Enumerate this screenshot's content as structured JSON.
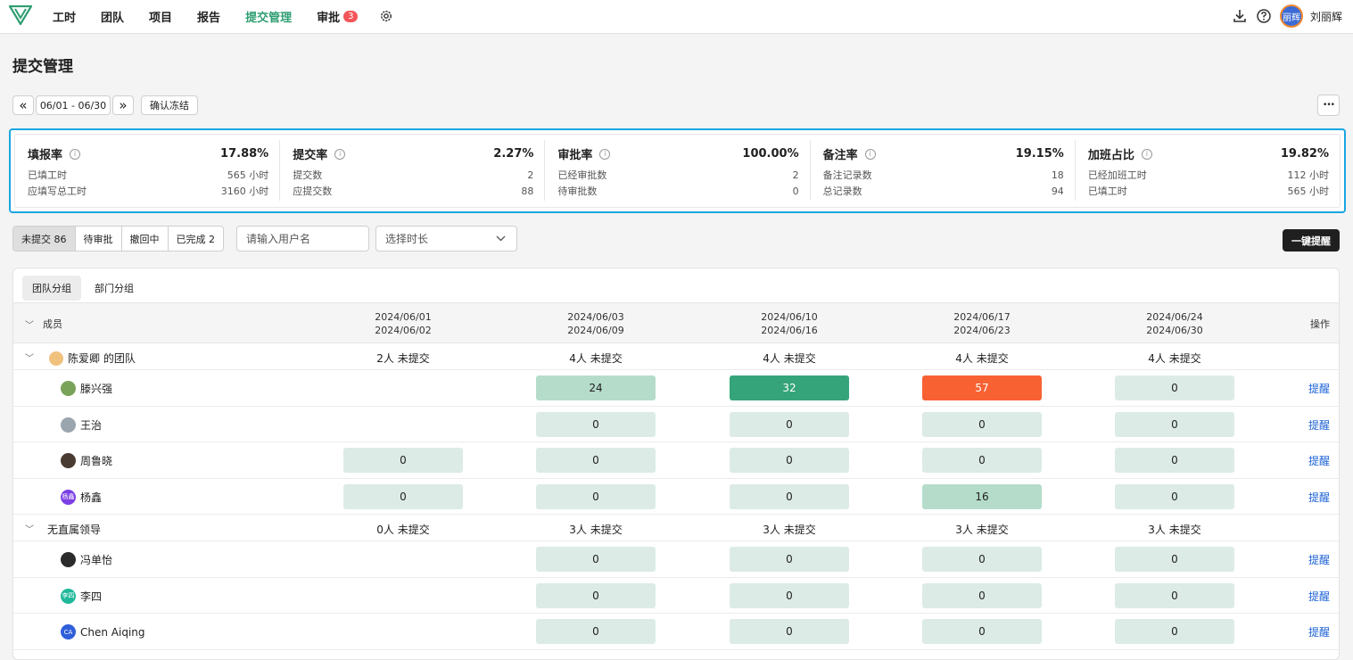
{
  "nav": {
    "items": [
      {
        "label": "工时"
      },
      {
        "label": "团队"
      },
      {
        "label": "项目"
      },
      {
        "label": "报告"
      },
      {
        "label": "提交管理",
        "active": true
      },
      {
        "label": "审批",
        "badge": "3"
      }
    ],
    "user": {
      "avatar_text": "丽辉",
      "name": "刘丽辉"
    }
  },
  "page": {
    "title": "提交管理"
  },
  "toolbar": {
    "date_range": "06/01 - 06/30",
    "freeze_label": "确认冻结",
    "more_label": "•••"
  },
  "stats": [
    {
      "title": "填报率",
      "value": "17.88%",
      "rows": [
        {
          "label": "已填工时",
          "value": "565 小时"
        },
        {
          "label": "应填写总工时",
          "value": "3160 小时"
        }
      ]
    },
    {
      "title": "提交率",
      "value": "2.27%",
      "rows": [
        {
          "label": "提交数",
          "value": "2"
        },
        {
          "label": "应提交数",
          "value": "88"
        }
      ]
    },
    {
      "title": "审批率",
      "value": "100.00%",
      "rows": [
        {
          "label": "已经审批数",
          "value": "2"
        },
        {
          "label": "待审批数",
          "value": "0"
        }
      ]
    },
    {
      "title": "备注率",
      "value": "19.15%",
      "rows": [
        {
          "label": "备注记录数",
          "value": "18"
        },
        {
          "label": "总记录数",
          "value": "94"
        }
      ]
    },
    {
      "title": "加班占比",
      "value": "19.82%",
      "rows": [
        {
          "label": "已经加班工时",
          "value": "112 小时"
        },
        {
          "label": "已填工时",
          "value": "565 小时"
        }
      ]
    }
  ],
  "filters": {
    "tabs": [
      "未提交 86",
      "待审批",
      "撤回中",
      "已完成 2"
    ],
    "username_placeholder": "请输入用户名",
    "duration_placeholder": "选择时长",
    "remind_all_label": "一键提醒"
  },
  "table": {
    "group_tabs": [
      "团队分组",
      "部门分组"
    ],
    "member_header": "成员",
    "action_header": "操作",
    "weeks": [
      {
        "start": "2024/06/01",
        "end": "2024/06/02"
      },
      {
        "start": "2024/06/03",
        "end": "2024/06/09"
      },
      {
        "start": "2024/06/10",
        "end": "2024/06/16"
      },
      {
        "start": "2024/06/17",
        "end": "2024/06/23"
      },
      {
        "start": "2024/06/24",
        "end": "2024/06/30"
      }
    ],
    "remind_label": "提醒",
    "groups": [
      {
        "name": "陈爱卿 的团队",
        "counts": [
          "2人 未提交",
          "4人 未提交",
          "4人 未提交",
          "4人 未提交",
          "4人 未提交"
        ],
        "members": [
          {
            "name": "滕兴强",
            "avatar_color": "#7aa35a",
            "hours": [
              "",
              "24",
              "32",
              "57",
              "0"
            ]
          },
          {
            "name": "王治",
            "avatar_color": "#9aa5ad",
            "hours": [
              "",
              "0",
              "0",
              "0",
              "0"
            ]
          },
          {
            "name": "周鲁晓",
            "avatar_color": "#4a3b32",
            "hours": [
              "0",
              "0",
              "0",
              "0",
              "0"
            ]
          },
          {
            "name": "杨鑫",
            "avatar_color": "#7b3fe4",
            "avatar_text": "杨鑫",
            "hours": [
              "0",
              "0",
              "0",
              "16",
              "0"
            ]
          }
        ]
      },
      {
        "name": "无直属领导",
        "counts": [
          "0人 未提交",
          "3人 未提交",
          "3人 未提交",
          "3人 未提交",
          "3人 未提交"
        ],
        "members": [
          {
            "name": "冯单怡",
            "avatar_color": "#2b2b2b",
            "hours": [
              "",
              "0",
              "0",
              "0",
              "0"
            ]
          },
          {
            "name": "李四",
            "avatar_color": "#1fb89a",
            "avatar_text": "李四",
            "hours": [
              "",
              "0",
              "0",
              "0",
              "0"
            ]
          },
          {
            "name": "Chen Aiqing",
            "avatar_color": "#2f5fd9",
            "avatar_text": "CA",
            "hours": [
              "",
              "0",
              "0",
              "0",
              "0"
            ]
          }
        ]
      }
    ]
  },
  "colors": {
    "accent": "#2e9e72",
    "zero": "#dcebe6",
    "light": "#b5dccb",
    "medium": "#35a47a",
    "high": "#f86233",
    "link": "#1e63d6"
  }
}
